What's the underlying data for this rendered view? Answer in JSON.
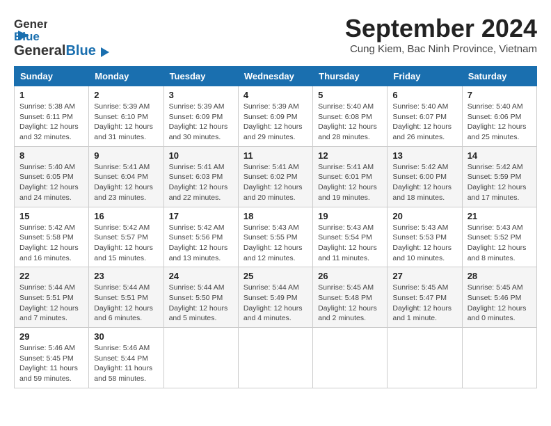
{
  "header": {
    "logo_general": "General",
    "logo_blue": "Blue",
    "title": "September 2024",
    "subtitle": "Cung Kiem, Bac Ninh Province, Vietnam"
  },
  "weekdays": [
    "Sunday",
    "Monday",
    "Tuesday",
    "Wednesday",
    "Thursday",
    "Friday",
    "Saturday"
  ],
  "weeks": [
    [
      {
        "day": "1",
        "sunrise": "5:38 AM",
        "sunset": "6:11 PM",
        "daylight": "12 hours and 32 minutes."
      },
      {
        "day": "2",
        "sunrise": "5:39 AM",
        "sunset": "6:10 PM",
        "daylight": "12 hours and 31 minutes."
      },
      {
        "day": "3",
        "sunrise": "5:39 AM",
        "sunset": "6:09 PM",
        "daylight": "12 hours and 30 minutes."
      },
      {
        "day": "4",
        "sunrise": "5:39 AM",
        "sunset": "6:09 PM",
        "daylight": "12 hours and 29 minutes."
      },
      {
        "day": "5",
        "sunrise": "5:40 AM",
        "sunset": "6:08 PM",
        "daylight": "12 hours and 28 minutes."
      },
      {
        "day": "6",
        "sunrise": "5:40 AM",
        "sunset": "6:07 PM",
        "daylight": "12 hours and 26 minutes."
      },
      {
        "day": "7",
        "sunrise": "5:40 AM",
        "sunset": "6:06 PM",
        "daylight": "12 hours and 25 minutes."
      }
    ],
    [
      {
        "day": "8",
        "sunrise": "5:40 AM",
        "sunset": "6:05 PM",
        "daylight": "12 hours and 24 minutes."
      },
      {
        "day": "9",
        "sunrise": "5:41 AM",
        "sunset": "6:04 PM",
        "daylight": "12 hours and 23 minutes."
      },
      {
        "day": "10",
        "sunrise": "5:41 AM",
        "sunset": "6:03 PM",
        "daylight": "12 hours and 22 minutes."
      },
      {
        "day": "11",
        "sunrise": "5:41 AM",
        "sunset": "6:02 PM",
        "daylight": "12 hours and 20 minutes."
      },
      {
        "day": "12",
        "sunrise": "5:41 AM",
        "sunset": "6:01 PM",
        "daylight": "12 hours and 19 minutes."
      },
      {
        "day": "13",
        "sunrise": "5:42 AM",
        "sunset": "6:00 PM",
        "daylight": "12 hours and 18 minutes."
      },
      {
        "day": "14",
        "sunrise": "5:42 AM",
        "sunset": "5:59 PM",
        "daylight": "12 hours and 17 minutes."
      }
    ],
    [
      {
        "day": "15",
        "sunrise": "5:42 AM",
        "sunset": "5:58 PM",
        "daylight": "12 hours and 16 minutes."
      },
      {
        "day": "16",
        "sunrise": "5:42 AM",
        "sunset": "5:57 PM",
        "daylight": "12 hours and 15 minutes."
      },
      {
        "day": "17",
        "sunrise": "5:42 AM",
        "sunset": "5:56 PM",
        "daylight": "12 hours and 13 minutes."
      },
      {
        "day": "18",
        "sunrise": "5:43 AM",
        "sunset": "5:55 PM",
        "daylight": "12 hours and 12 minutes."
      },
      {
        "day": "19",
        "sunrise": "5:43 AM",
        "sunset": "5:54 PM",
        "daylight": "12 hours and 11 minutes."
      },
      {
        "day": "20",
        "sunrise": "5:43 AM",
        "sunset": "5:53 PM",
        "daylight": "12 hours and 10 minutes."
      },
      {
        "day": "21",
        "sunrise": "5:43 AM",
        "sunset": "5:52 PM",
        "daylight": "12 hours and 8 minutes."
      }
    ],
    [
      {
        "day": "22",
        "sunrise": "5:44 AM",
        "sunset": "5:51 PM",
        "daylight": "12 hours and 7 minutes."
      },
      {
        "day": "23",
        "sunrise": "5:44 AM",
        "sunset": "5:51 PM",
        "daylight": "12 hours and 6 minutes."
      },
      {
        "day": "24",
        "sunrise": "5:44 AM",
        "sunset": "5:50 PM",
        "daylight": "12 hours and 5 minutes."
      },
      {
        "day": "25",
        "sunrise": "5:44 AM",
        "sunset": "5:49 PM",
        "daylight": "12 hours and 4 minutes."
      },
      {
        "day": "26",
        "sunrise": "5:45 AM",
        "sunset": "5:48 PM",
        "daylight": "12 hours and 2 minutes."
      },
      {
        "day": "27",
        "sunrise": "5:45 AM",
        "sunset": "5:47 PM",
        "daylight": "12 hours and 1 minute."
      },
      {
        "day": "28",
        "sunrise": "5:45 AM",
        "sunset": "5:46 PM",
        "daylight": "12 hours and 0 minutes."
      }
    ],
    [
      {
        "day": "29",
        "sunrise": "5:46 AM",
        "sunset": "5:45 PM",
        "daylight": "11 hours and 59 minutes."
      },
      {
        "day": "30",
        "sunrise": "5:46 AM",
        "sunset": "5:44 PM",
        "daylight": "11 hours and 58 minutes."
      },
      null,
      null,
      null,
      null,
      null
    ]
  ]
}
